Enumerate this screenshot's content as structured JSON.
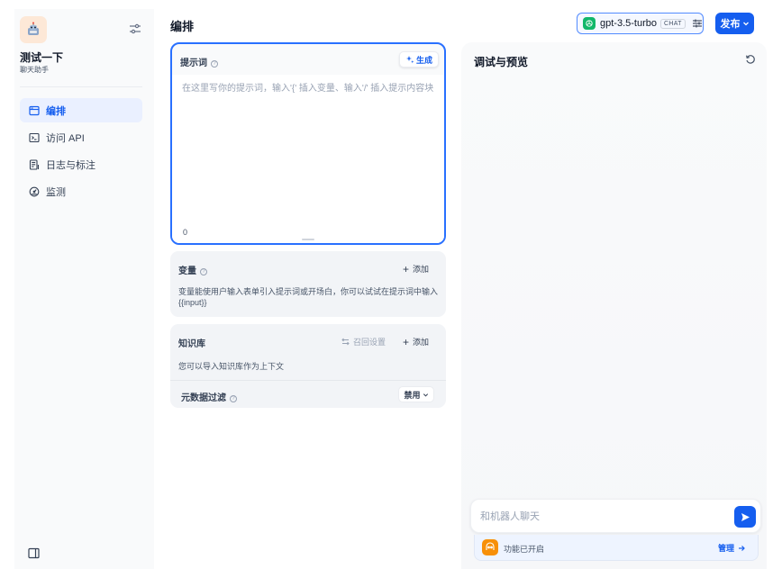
{
  "app": {
    "name": "测试一下",
    "type": "聊天助手",
    "icon": "robot-icon"
  },
  "sidebar": {
    "items": [
      {
        "label": "编排",
        "icon": "layout-icon",
        "active": true
      },
      {
        "label": "访问 API",
        "icon": "terminal-icon",
        "active": false
      },
      {
        "label": "日志与标注",
        "icon": "log-icon",
        "active": false
      },
      {
        "label": "监测",
        "icon": "dashboard-icon",
        "active": false
      }
    ]
  },
  "header": {
    "title": "编排",
    "model_name": "gpt-3.5-turbo",
    "model_badge": "CHAT",
    "publish_label": "发布"
  },
  "prompt": {
    "title": "提示词",
    "generate_label": "生成",
    "placeholder": "在这里写你的提示词，输入'{' 插入变量、输入'/' 插入提示内容块",
    "value": "",
    "char_count": "0"
  },
  "variables": {
    "title": "变量",
    "add_label": "添加",
    "description": "变量能使用户输入表单引入提示词或开场白，你可以试试在提示词中输入 {{input}}"
  },
  "knowledge": {
    "title": "知识库",
    "recall_label": "召回设置",
    "add_label": "添加",
    "description": "您可以导入知识库作为上下文",
    "metadata_title": "元数据过滤",
    "metadata_value": "禁用"
  },
  "debug": {
    "title": "调试与预览",
    "chat_placeholder": "和机器人聊天",
    "feature_text": "功能已开启",
    "manage_label": "管理"
  },
  "colors": {
    "primary": "#155eef",
    "sidebar_active_bg": "#eaf0ff",
    "model_logo": "#12b76a",
    "feature_icon": "#f79009"
  }
}
